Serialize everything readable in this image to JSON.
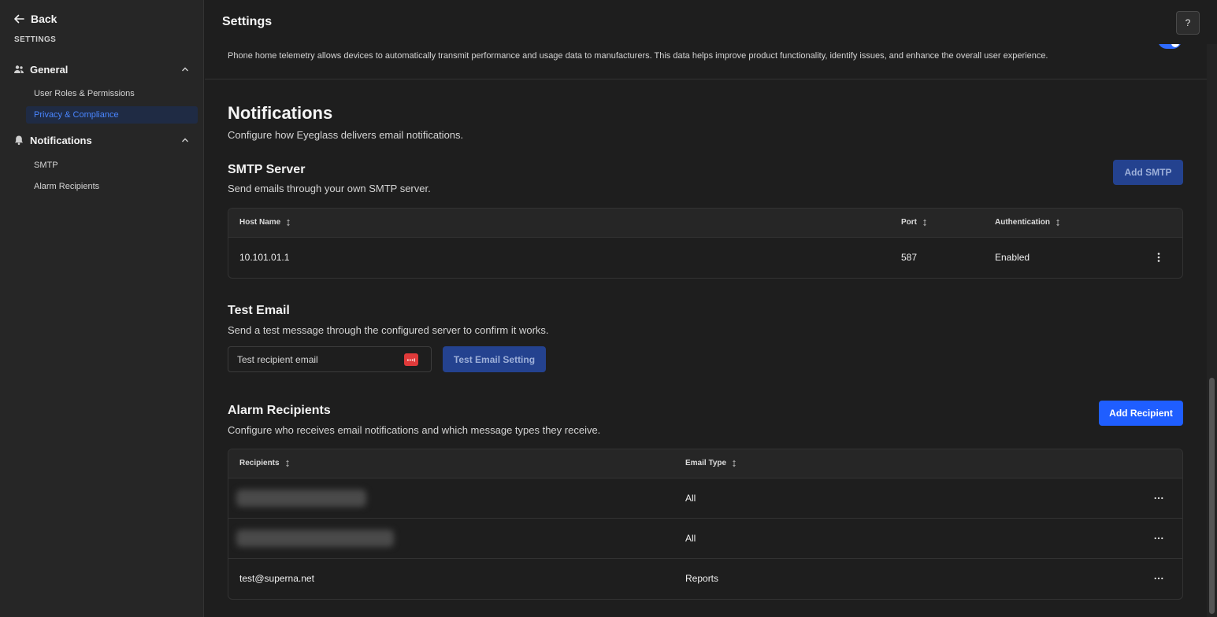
{
  "sidebar": {
    "back_label": "Back",
    "section_label": "SETTINGS",
    "groups": [
      {
        "label": "General",
        "icon": "users-icon",
        "items": [
          {
            "label": "User Roles & Permissions",
            "active": false
          },
          {
            "label": "Privacy & Compliance",
            "active": true
          }
        ]
      },
      {
        "label": "Notifications",
        "icon": "bell-icon",
        "items": [
          {
            "label": "SMTP",
            "active": false
          },
          {
            "label": "Alarm Recipients",
            "active": false
          }
        ]
      }
    ]
  },
  "header": {
    "title": "Settings",
    "help_label": "?"
  },
  "telemetry": {
    "description": "Phone home telemetry allows devices to automatically transmit performance and usage data to manufacturers. This data helps improve product functionality, identify issues, and enhance the overall user experience.",
    "enabled": true
  },
  "notifications": {
    "title": "Notifications",
    "description": "Configure how Eyeglass delivers email notifications."
  },
  "smtp": {
    "title": "SMTP Server",
    "description": "Send emails through your own SMTP server.",
    "add_button": "Add SMTP",
    "columns": [
      "Host Name",
      "Port",
      "Authentication"
    ],
    "rows": [
      {
        "host": "10.101.01.1",
        "port": "587",
        "auth": "Enabled"
      }
    ]
  },
  "test_email": {
    "title": "Test Email",
    "description": "Send a test message through the configured server to confirm it works.",
    "placeholder": "Test recipient email",
    "button": "Test Email Setting"
  },
  "alarm_recipients": {
    "title": "Alarm Recipients",
    "description": "Configure who receives email notifications and which message types they receive.",
    "add_button": "Add Recipient",
    "columns": [
      "Recipients",
      "Email Type"
    ],
    "rows": [
      {
        "recipient": "",
        "type": "All",
        "redacted": true
      },
      {
        "recipient": "",
        "type": "All",
        "redacted": true
      },
      {
        "recipient": "test@superna.net",
        "type": "Reports",
        "redacted": false
      }
    ]
  },
  "colors": {
    "accent": "#1f5eff",
    "active_nav": "#4a86ff",
    "background": "#1e1e1e"
  }
}
